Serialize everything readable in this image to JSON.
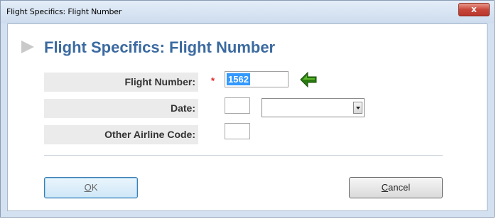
{
  "window": {
    "title": "Flight Specifics: Flight Number",
    "close_label": "x"
  },
  "heading": "Flight Specifics: Flight Number",
  "form": {
    "flight_number_label": "Flight Number:",
    "required_marker": "*",
    "flight_number_value": "1562",
    "date_label": "Date:",
    "date_day_value": "",
    "date_select_value": "",
    "other_airline_label": "Other Airline Code:",
    "other_airline_value": ""
  },
  "buttons": {
    "ok_label": "OK",
    "cancel_label": "Cancel"
  },
  "icons": {
    "heading_marker": "triangle-right-icon",
    "focus_indicator": "green-arrow-left-icon",
    "dropdown": "chevron-down-icon"
  },
  "colors": {
    "heading": "#3b6aa0",
    "required": "#dd2222",
    "selection": "#3399ff",
    "indicator": "#2a7a10"
  }
}
